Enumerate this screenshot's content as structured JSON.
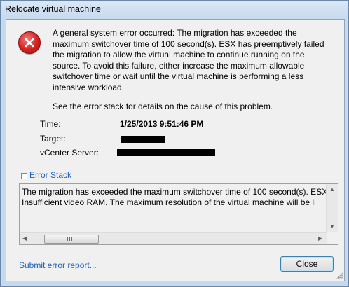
{
  "window": {
    "title": "Relocate virtual machine"
  },
  "error": {
    "icon": "error-icon",
    "message_lines": [
      "A general system error occurred: The migration has exceeded the",
      "maximum switchover time of 100 second(s).  ESX has preemptively failed",
      "the migration to allow the virtual machine to continue running on the",
      "source. To avoid this failure, either increase the maximum allowable",
      "switchover time or wait until the virtual machine is performing a less",
      "intensive workload."
    ],
    "stack_hint": "See the error stack for details on the cause of this problem."
  },
  "info": {
    "time_label": "Time:",
    "time_value": "1/25/2013 9:51:46 PM",
    "target_label": "Target:",
    "vcenter_label": "vCenter Server:"
  },
  "error_stack": {
    "toggle_label": "Error Stack",
    "lines": [
      "The migration has exceeded the maximum switchover time of 100 second(s). ESX",
      "Insufficient video RAM. The maximum resolution of the virtual machine will be li"
    ]
  },
  "footer": {
    "submit_link": "Submit error report...",
    "close_label": "Close"
  },
  "colors": {
    "link": "#1f5fbf",
    "error_red": "#d42020"
  }
}
